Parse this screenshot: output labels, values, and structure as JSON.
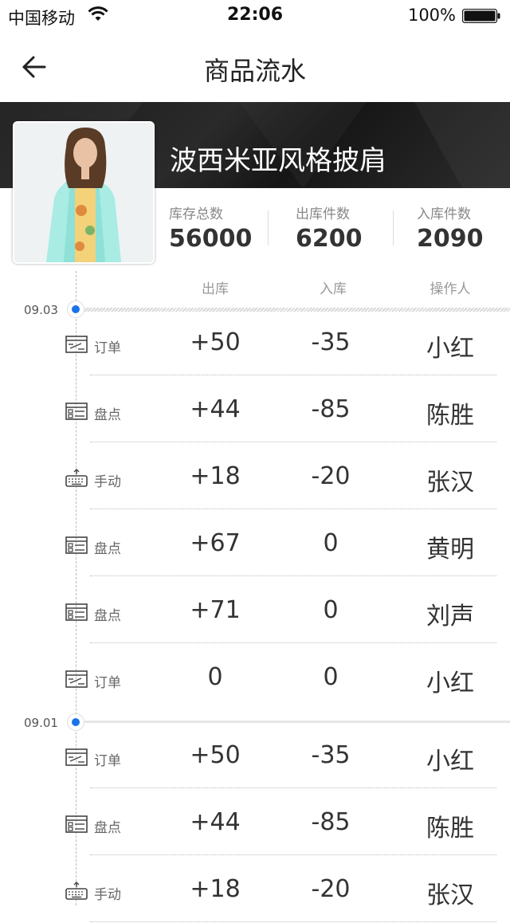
{
  "status": {
    "carrier": "中国移动",
    "time": "22:06",
    "battery": "100%"
  },
  "nav": {
    "title": "商品流水"
  },
  "product": {
    "name": "波西米亚风格披肩"
  },
  "stats": [
    {
      "label": "库存总数",
      "value": "56000"
    },
    {
      "label": "出库件数",
      "value": "6200"
    },
    {
      "label": "入库件数",
      "value": "2090"
    }
  ],
  "columns": {
    "out": "出库",
    "in": "入库",
    "operator": "操作人"
  },
  "groups": [
    {
      "date": "09.03",
      "rows": [
        {
          "type": "订单",
          "icon": "order-icon",
          "out": "+50",
          "in": "-35",
          "operator": "小红"
        },
        {
          "type": "盘点",
          "icon": "inventory-icon",
          "out": "+44",
          "in": "-85",
          "operator": "陈胜"
        },
        {
          "type": "手动",
          "icon": "keyboard-icon",
          "out": "+18",
          "in": "-20",
          "operator": "张汉"
        },
        {
          "type": "盘点",
          "icon": "inventory-icon",
          "out": "+67",
          "in": "0",
          "operator": "黄明"
        },
        {
          "type": "盘点",
          "icon": "inventory-icon",
          "out": "+71",
          "in": "0",
          "operator": "刘声"
        },
        {
          "type": "订单",
          "icon": "order-icon",
          "out": "0",
          "in": "0",
          "operator": "小红"
        }
      ]
    },
    {
      "date": "09.01",
      "rows": [
        {
          "type": "订单",
          "icon": "order-icon",
          "out": "+50",
          "in": "-35",
          "operator": "小红"
        },
        {
          "type": "盘点",
          "icon": "inventory-icon",
          "out": "+44",
          "in": "-85",
          "operator": "陈胜"
        },
        {
          "type": "手动",
          "icon": "keyboard-icon",
          "out": "+18",
          "in": "-20",
          "operator": "张汉"
        }
      ]
    }
  ],
  "colors": {
    "accent": "#1a73e8",
    "banner": "#1f1f1f"
  }
}
